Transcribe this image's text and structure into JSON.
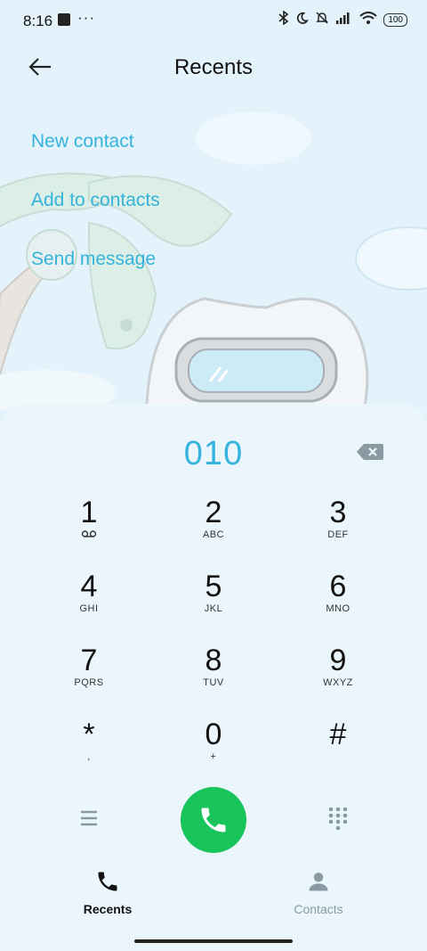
{
  "status_bar": {
    "time": "8:16",
    "dots": "···",
    "battery": "100"
  },
  "header": {
    "title": "Recents"
  },
  "options": [
    {
      "label": "New contact"
    },
    {
      "label": "Add to contacts"
    },
    {
      "label": "Send message"
    }
  ],
  "dialer": {
    "number": "010"
  },
  "keys": [
    {
      "digit": "1",
      "letters": ""
    },
    {
      "digit": "2",
      "letters": "ABC"
    },
    {
      "digit": "3",
      "letters": "DEF"
    },
    {
      "digit": "4",
      "letters": "GHI"
    },
    {
      "digit": "5",
      "letters": "JKL"
    },
    {
      "digit": "6",
      "letters": "MNO"
    },
    {
      "digit": "7",
      "letters": "PQRS"
    },
    {
      "digit": "8",
      "letters": "TUV"
    },
    {
      "digit": "9",
      "letters": "WXYZ"
    },
    {
      "digit": "*",
      "letters": ","
    },
    {
      "digit": "0",
      "letters": "+"
    },
    {
      "digit": "#",
      "letters": ""
    }
  ],
  "nav": {
    "recents": "Recents",
    "contacts": "Contacts"
  },
  "colors": {
    "accent": "#34b3dc",
    "call": "#19c45b",
    "background": "#e4f3fb"
  },
  "icons": [
    "back-arrow-icon",
    "backspace-icon",
    "voicemail-icon",
    "menu-icon",
    "phone-icon",
    "dialpad-icon",
    "person-icon"
  ]
}
